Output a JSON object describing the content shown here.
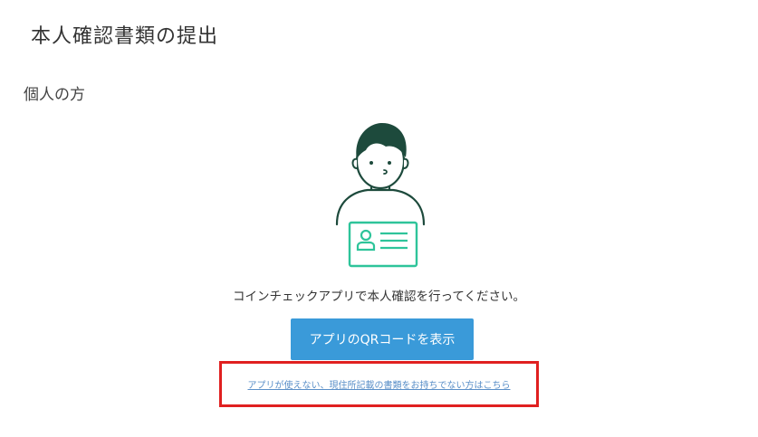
{
  "header": {
    "title": "本人確認書類の提出"
  },
  "section": {
    "title": "個人の方"
  },
  "illustration": {
    "icon": "person-with-id-card",
    "colors": {
      "line": "#1d4a3c",
      "hair": "#1d4a3c",
      "card": "#2ec49a"
    }
  },
  "main": {
    "instruction": "コインチェックアプリで本人確認を行ってください。",
    "qr_button_label": "アプリのQRコードを表示",
    "alt_link_label": "アプリが使えない、現住所記載の書類をお持ちでない方はこちら"
  },
  "colors": {
    "button_bg": "#3a9ad9",
    "link": "#5a8fc8",
    "highlight": "#e02020"
  }
}
